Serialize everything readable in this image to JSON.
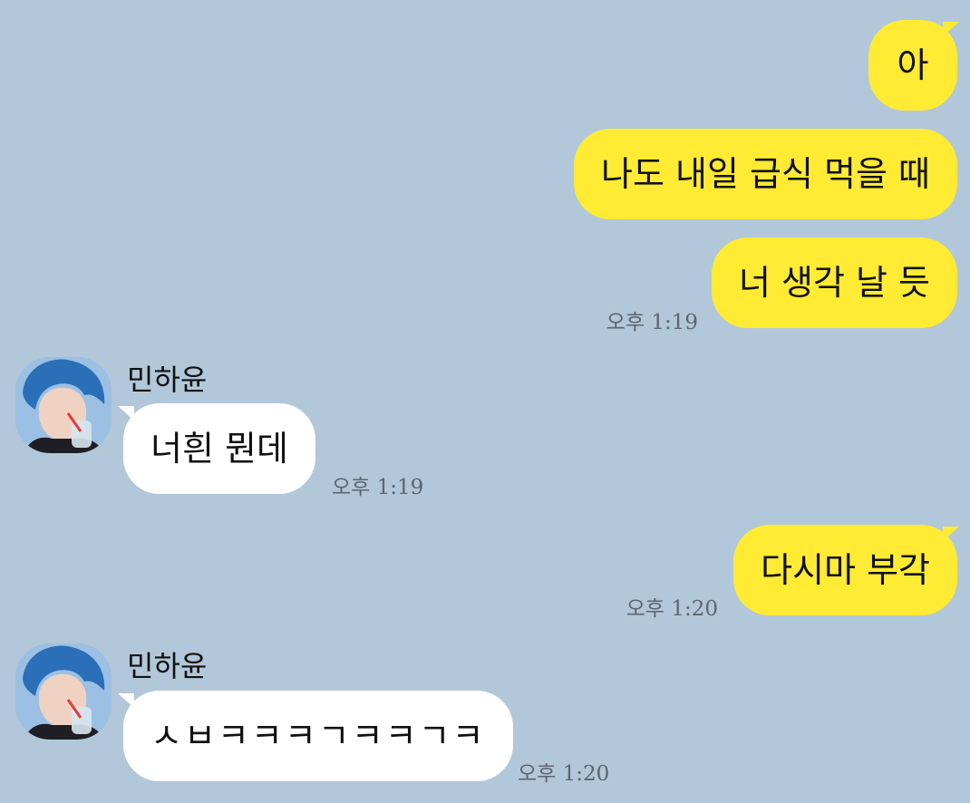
{
  "messages": [
    {
      "sender": "me",
      "text": "아"
    },
    {
      "sender": "me",
      "text": "나도 내일 급식 먹을 때"
    },
    {
      "sender": "me",
      "text": "너 생각 날 듯",
      "time": "오후 1:19"
    },
    {
      "sender": "other",
      "name": "민하윤",
      "text": "너흰 뭔데",
      "time": "오후 1:19"
    },
    {
      "sender": "me",
      "text": "다시마 부각",
      "time": "오후 1:20"
    },
    {
      "sender": "other",
      "name": "민하윤",
      "text": "ㅅㅂㅋㅋㅋㄱㅋㅋㄱㅋ",
      "time": "오후 1:20"
    }
  ],
  "colors": {
    "background": "#b2c7d9",
    "my_bubble": "#ffeb33",
    "other_bubble": "#ffffff",
    "timestamp": "#5c6670"
  },
  "icons": {
    "profile": "avatar-photo"
  }
}
